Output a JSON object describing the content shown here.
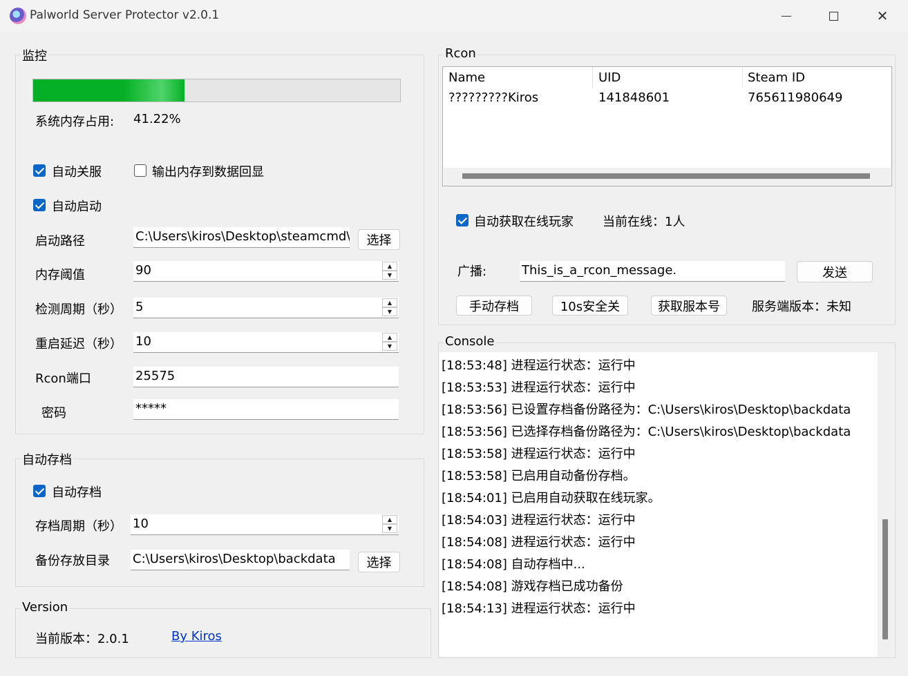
{
  "window": {
    "title": "Palworld Server Protector v2.0.1",
    "minimize_glyph": "─",
    "maximize_glyph": "☐",
    "close_glyph": "✕"
  },
  "monitor": {
    "title": "监控",
    "memory_progress": 0.4122,
    "memory_label": "系统内存占用:",
    "memory_value": "41.22%",
    "auto_shutdown_label": "自动关服",
    "auto_shutdown_checked": true,
    "output_memory_label": "输出内存到数据回显",
    "output_memory_checked": false,
    "auto_start_label": "自动启动",
    "auto_start_checked": true,
    "start_path_label": "启动路径",
    "start_path_value": "C:\\Users\\kiros\\Desktop\\steamcmd\\s",
    "choose_label": "选择",
    "mem_threshold_label": "内存阈值",
    "mem_threshold_value": "90",
    "check_interval_label": "检测周期（秒）",
    "check_interval_value": "5",
    "restart_delay_label": "重启延迟（秒）",
    "restart_delay_value": "10",
    "rcon_port_label": "Rcon端口",
    "rcon_port_value": "25575",
    "password_label": "密码",
    "password_value": "*****"
  },
  "autosave": {
    "title": "自动存档",
    "enable_label": "自动存档",
    "enable_checked": true,
    "period_label": "存档周期（秒）",
    "period_value": "10",
    "backup_dir_label": "备份存放目录",
    "backup_dir_value": "C:\\Users\\kiros\\Desktop\\backdata",
    "choose_label": "选择"
  },
  "version": {
    "title": "Version",
    "current_label": "当前版本：2.0.1",
    "author_link": " By Kiros"
  },
  "rcon": {
    "title": "Rcon",
    "columns": [
      "Name",
      "UID",
      "Steam ID"
    ],
    "rows": [
      [
        "?????????Kiros",
        "141848601",
        "765611980649"
      ]
    ],
    "auto_fetch_label": "自动获取在线玩家",
    "auto_fetch_checked": true,
    "online_label": "当前在线：1人",
    "broadcast_label": "广播:",
    "broadcast_value": "This_is_a_rcon_message.",
    "send_label": "发送",
    "manual_save_label": "手动存档",
    "safe_shutdown_label": "10s安全关",
    "get_version_label": "获取服本号",
    "server_version_label": "服务端版本：未知"
  },
  "console": {
    "title": "Console",
    "lines": [
      "[18:53:48] 进程运行状态：运行中",
      "[18:53:53] 进程运行状态：运行中",
      "[18:53:56] 已设置存档备份路径为：C:\\Users\\kiros\\Desktop\\backdata",
      "[18:53:56] 已选择存档备份路径为：C:\\Users\\kiros\\Desktop\\backdata",
      "[18:53:58] 进程运行状态：运行中",
      "[18:53:58] 已启用自动备份存档。",
      "[18:54:01] 已启用自动获取在线玩家。",
      "[18:54:03] 进程运行状态：运行中",
      "[18:54:08] 进程运行状态：运行中",
      "[18:54:08] 自动存档中...",
      "[18:54:08] 游戏存档已成功备份",
      "[18:54:13] 进程运行状态：运行中"
    ]
  },
  "colors": {
    "progress_fill": "#06b025",
    "checkbox": "#0a67c7",
    "link": "#0033cc"
  }
}
